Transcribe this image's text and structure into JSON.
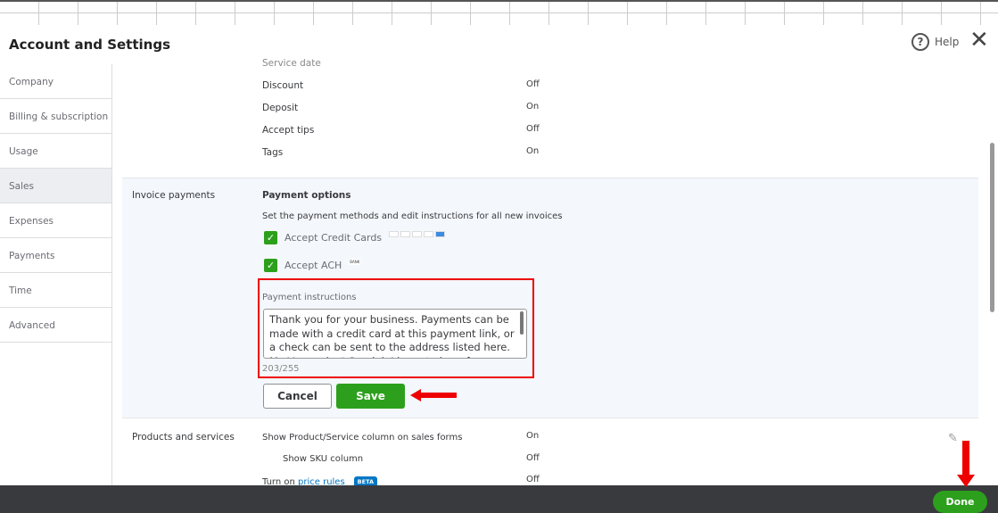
{
  "header": {
    "title": "Account and Settings",
    "help": "Help"
  },
  "sidebar": [
    "Company",
    "Billing & subscription",
    "Usage",
    "Sales",
    "Expenses",
    "Payments",
    "Time",
    "Advanced"
  ],
  "settings_top": [
    {
      "label": "Service date",
      "value": ""
    },
    {
      "label": "Discount",
      "value": "Off"
    },
    {
      "label": "Deposit",
      "value": "On"
    },
    {
      "label": "Accept tips",
      "value": "Off"
    },
    {
      "label": "Tags",
      "value": "On"
    }
  ],
  "invoice_payments": {
    "section": "Invoice payments",
    "heading": "Payment options",
    "desc": "Set the payment methods and edit instructions for all new invoices",
    "credit_cards": "Accept Credit Cards",
    "ach": "Accept ACH",
    "ach_badge": "BANK",
    "instructions_label": "Payment instructions",
    "instructions": "Thank you for your business. Payments can be made with a credit card at this payment link, or a check can be sent to the address listed here. My Venmo is @Gemini. I hope to hear from you soon.",
    "count": "203/255",
    "cancel": "Cancel",
    "save": "Save"
  },
  "products": {
    "section": "Products and services",
    "rows": [
      {
        "label": "Show Product/Service column on sales forms",
        "value": "On"
      },
      {
        "label": "Show SKU column",
        "value": "Off"
      }
    ],
    "price_prefix": "Turn on ",
    "price_link": "price rules",
    "beta": "BETA",
    "price_value": "Off"
  },
  "footer": {
    "done": "Done"
  }
}
